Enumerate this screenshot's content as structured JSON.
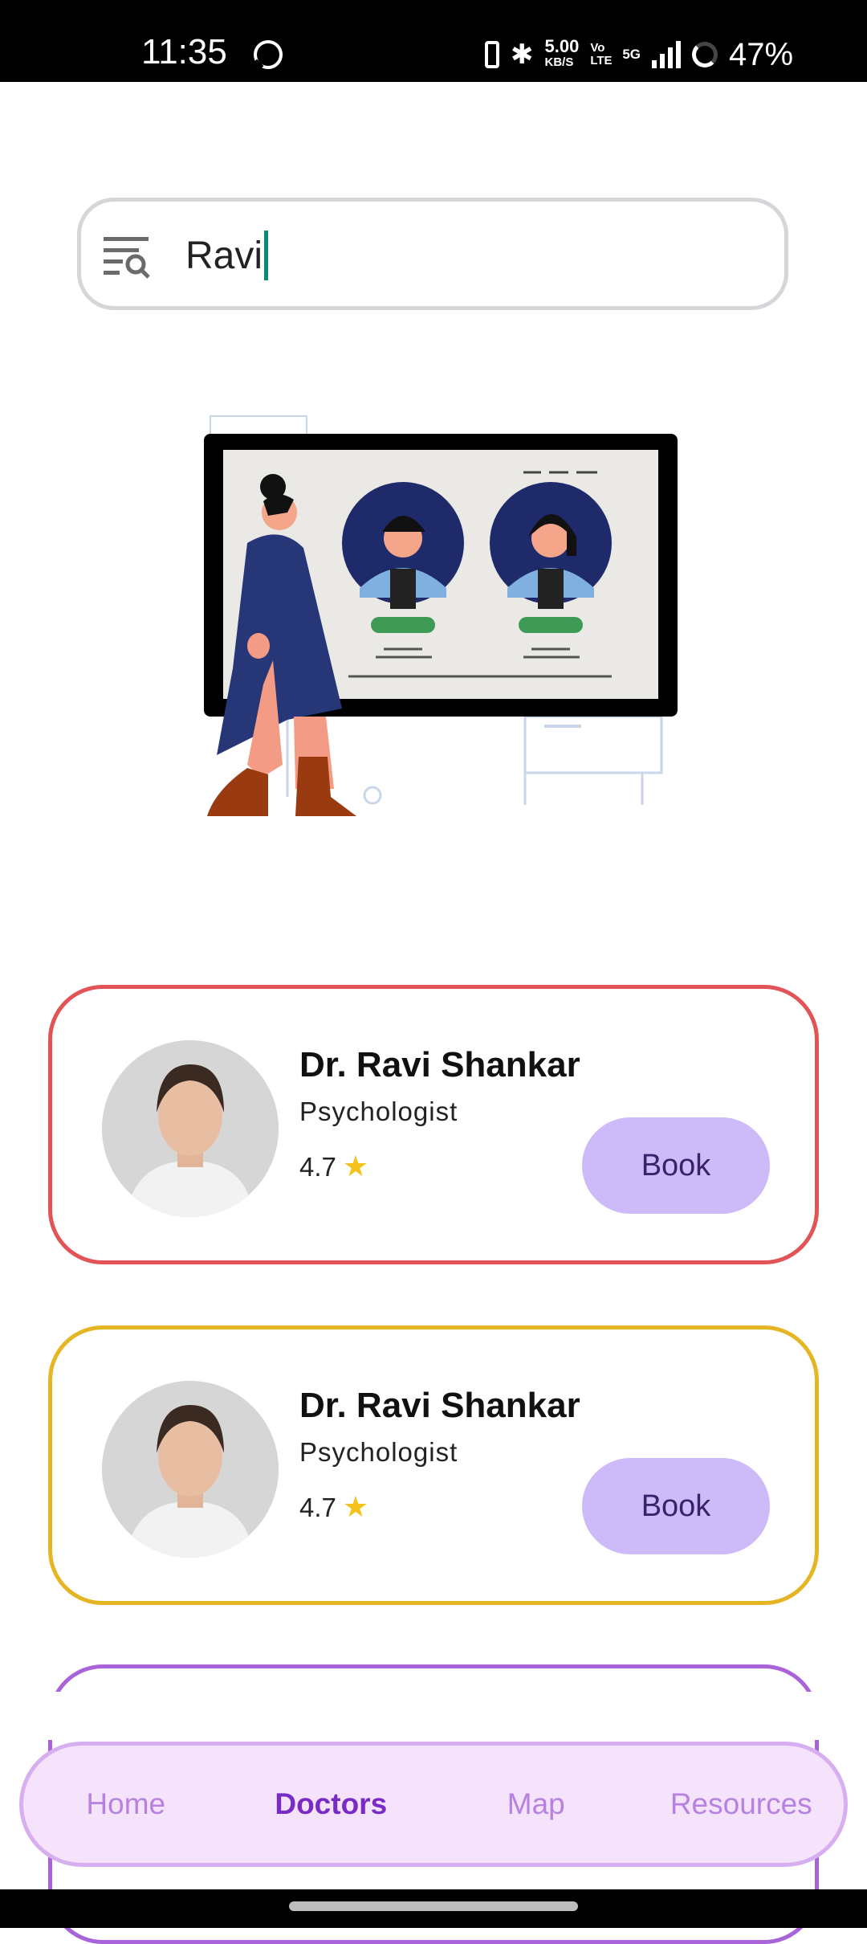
{
  "status_bar": {
    "time": "11:35",
    "net_speed": "5.00",
    "net_unit": "KB/S",
    "volte": "Vo LTE",
    "network": "5G",
    "battery": "47%"
  },
  "search": {
    "value": "Ravi"
  },
  "doctors": [
    {
      "name": "Dr. Ravi Shankar",
      "specialty": "Psychologist",
      "rating": "4.7",
      "book_label": "Book",
      "border_color": "#e25356"
    },
    {
      "name": "Dr. Ravi Shankar",
      "specialty": "Psychologist",
      "rating": "4.7",
      "book_label": "Book",
      "border_color": "#e6b524"
    },
    {
      "border_color": "#a863d8"
    }
  ],
  "nav": {
    "items": [
      {
        "label": "Home"
      },
      {
        "label": "Doctors",
        "active": true
      },
      {
        "label": "Map"
      },
      {
        "label": "Resources"
      }
    ]
  },
  "colors": {
    "accent": "#7a2bc6",
    "book_button": "#cdbaf9",
    "nav_background": "#f4e3fb",
    "caret": "#0b8a78"
  },
  "icons": {
    "search_filter": "filter-search-icon",
    "rating": "star-icon"
  }
}
